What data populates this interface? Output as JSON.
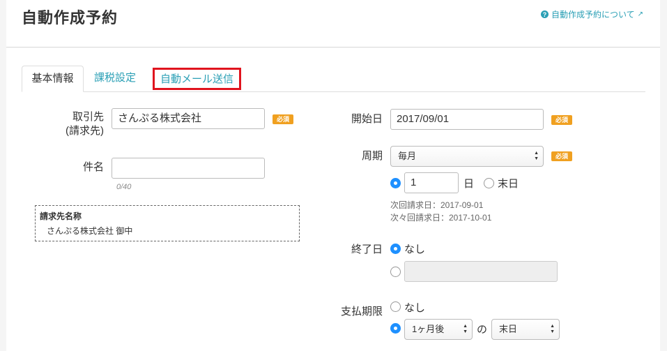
{
  "header": {
    "title": "自動作成予約",
    "help_link": "自動作成予約について",
    "help_icon": "question-circle-icon",
    "external_icon": "external-link-icon"
  },
  "tabs": [
    {
      "label": "基本情報",
      "active": true
    },
    {
      "label": "課税設定",
      "active": false
    },
    {
      "label": "自動メール送信",
      "active": false,
      "highlighted": true
    }
  ],
  "form": {
    "client": {
      "label_line1": "取引先",
      "label_line2": "(請求先)",
      "value": "さんぷる株式会社",
      "required": "必須"
    },
    "subject": {
      "label": "件名",
      "value": "",
      "counter": "0/40"
    },
    "billing_name": {
      "title": "請求先名称",
      "value": "さんぷる株式会社 御中"
    },
    "start_date": {
      "label": "開始日",
      "value": "2017/09/01",
      "required": "必須"
    },
    "cycle": {
      "label": "周期",
      "selected": "毎月",
      "required": "必須",
      "day_value": "1",
      "day_unit": "日",
      "end_of_month": "末日",
      "next_billing": "次回請求日：2017-09-01",
      "next_next_billing": "次々回請求日：2017-10-01"
    },
    "end_date": {
      "label": "終了日",
      "option_none": "なし",
      "value": ""
    },
    "payment_due": {
      "label": "支払期限",
      "option_none": "なし",
      "month_selected": "1ヶ月後",
      "connector": "の",
      "day_selected": "末日"
    }
  },
  "colors": {
    "accent": "#2a9fb5",
    "required_badge": "#f0a020",
    "highlight_border": "#e0141e",
    "radio_checked": "#1e90ff"
  }
}
